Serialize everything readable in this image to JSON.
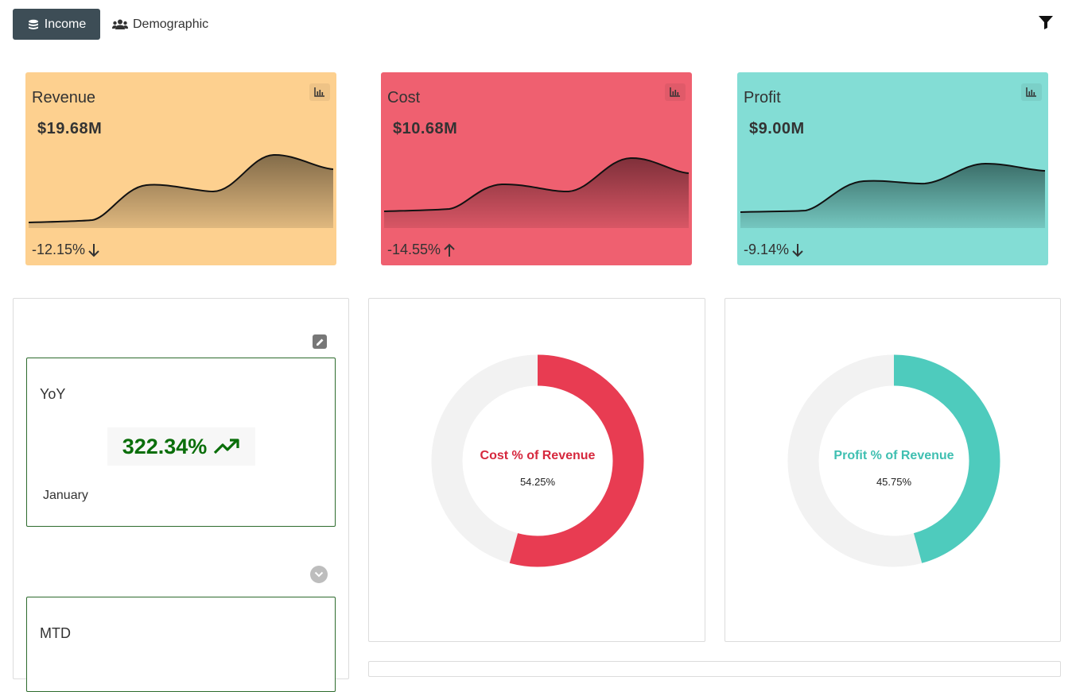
{
  "nav": {
    "tabs": [
      {
        "label": "Income",
        "icon": "coins-icon",
        "active": true
      },
      {
        "label": "Demographic",
        "icon": "users-icon",
        "active": false
      }
    ],
    "filter_icon": "filter-icon"
  },
  "kpis": [
    {
      "title": "Revenue",
      "value": "$19.68M",
      "change": "-12.15%",
      "direction": "down",
      "color": "#fdd08f"
    },
    {
      "title": "Cost",
      "value": "$10.68M",
      "change": "-14.55%",
      "direction": "up",
      "color": "#ef6070"
    },
    {
      "title": "Profit",
      "value": "$9.00M",
      "change": "-9.14%",
      "direction": "down",
      "color": "#83ddd5"
    }
  ],
  "comparison": {
    "yoy": {
      "label": "YoY",
      "value": "322.34%",
      "trend": "trending-up",
      "period": "January",
      "color": "#0a6e0a"
    },
    "mtd": {
      "label": "MTD"
    }
  },
  "donuts": [
    {
      "title": "Cost % of Revenue",
      "percent_label": "54.25%",
      "percent": 54.25,
      "color": "#e83c52"
    },
    {
      "title": "Profit % of Revenue",
      "percent_label": "45.75%",
      "percent": 45.75,
      "color": "#4ecbbd"
    }
  ]
}
